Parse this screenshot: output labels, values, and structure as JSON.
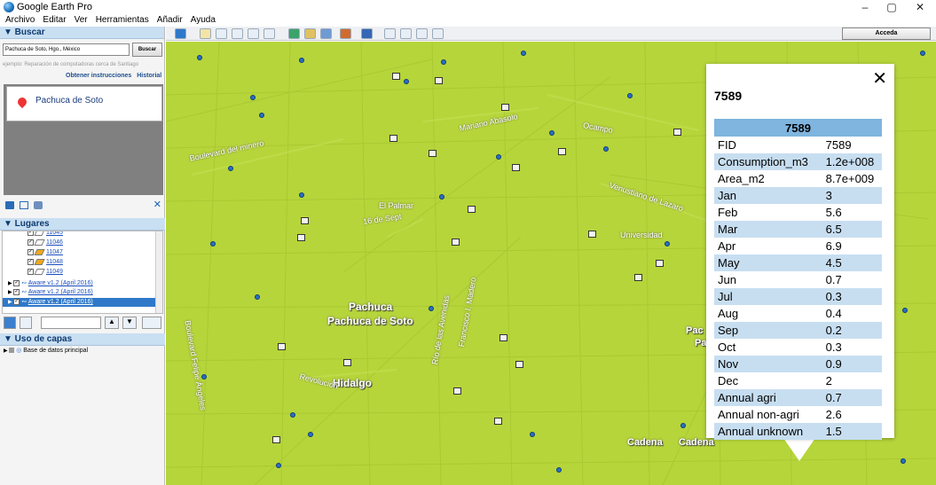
{
  "window": {
    "title": "Google Earth Pro",
    "controls": [
      "–",
      "▢",
      "✕"
    ]
  },
  "menu": [
    "Archivo",
    "Editar",
    "Ver",
    "Herramientas",
    "Añadir",
    "Ayuda"
  ],
  "search": {
    "header": "▼ Buscar",
    "value": "Pachuca de Soto, Hgo., México",
    "button": "Buscar",
    "hint": "ejemplo: Reparación de computadoras cerca de Santiago",
    "directions": "Obtener instrucciones",
    "history": "Historial",
    "result": "Pachuca de Soto"
  },
  "places": {
    "header": "▼ Lugares",
    "items": [
      {
        "label": "11045",
        "checked": true,
        "color": "#ffffff"
      },
      {
        "label": "11046",
        "checked": true,
        "color": "#ffffff"
      },
      {
        "label": "11047",
        "checked": true,
        "color": "#f0a81c"
      },
      {
        "label": "11048",
        "checked": true,
        "color": "#f0a81c"
      },
      {
        "label": "11049",
        "checked": true,
        "color": "#ffffff"
      },
      {
        "label": "Aware v1.2 (April 2016)",
        "checked": true
      },
      {
        "label": "Aware v1.2 (April 2016)",
        "checked": true
      },
      {
        "label": "Aware v1.2 (April 2016)",
        "checked": true,
        "selected": true
      }
    ]
  },
  "layers": {
    "header": "▼ Uso de capas",
    "items": [
      {
        "label": "Base de datos principal"
      }
    ]
  },
  "toolbar": {
    "access": "Acceda"
  },
  "map": {
    "labels": {
      "city1": "Pachuca",
      "city2": "Pachuca de Soto",
      "state": "Hidalgo",
      "cadena": "Cadena",
      "cadena2": "Cadena",
      "pac": "Pac",
      "pac2": "Pac",
      "universidad": "Universidad",
      "mariano": "Mariano Abasolo",
      "ocampo": "Ocampo",
      "real": "El Palmar",
      "sep": "16 de Sept",
      "minero": "Boulevard del minero",
      "lazaro": "Venustiano de Lazaro",
      "rio": "Río de las Avenidas",
      "madero": "Francisco I. Madero",
      "felipe": "Boulevard Felipe Ángeles",
      "revolucion": "Revolución"
    }
  },
  "popup": {
    "title": "7589",
    "table_header": "7589",
    "rows": [
      {
        "key": "FID",
        "value": "7589"
      },
      {
        "key": "Consumption_m3",
        "value": "1.2e+008"
      },
      {
        "key": "Area_m2",
        "value": "8.7e+009"
      },
      {
        "key": "Jan",
        "value": "3"
      },
      {
        "key": "Feb",
        "value": "5.6"
      },
      {
        "key": "Mar",
        "value": "6.5"
      },
      {
        "key": "Apr",
        "value": "6.9"
      },
      {
        "key": "May",
        "value": "4.5"
      },
      {
        "key": "Jun",
        "value": "0.7"
      },
      {
        "key": "Jul",
        "value": "0.3"
      },
      {
        "key": "Aug",
        "value": "0.4"
      },
      {
        "key": "Sep",
        "value": "0.2"
      },
      {
        "key": "Oct",
        "value": "0.3"
      },
      {
        "key": "Nov",
        "value": "0.9"
      },
      {
        "key": "Dec",
        "value": "2"
      },
      {
        "key": "Annual agri",
        "value": "0.7"
      },
      {
        "key": "Annual non-agri",
        "value": "2.6"
      },
      {
        "key": "Annual unknown",
        "value": "1.5"
      }
    ]
  },
  "colors": {
    "map": "#b6d53a",
    "header": "#7fb5de",
    "alt_row": "#c7def1",
    "panel_header": "#c9dff2"
  }
}
